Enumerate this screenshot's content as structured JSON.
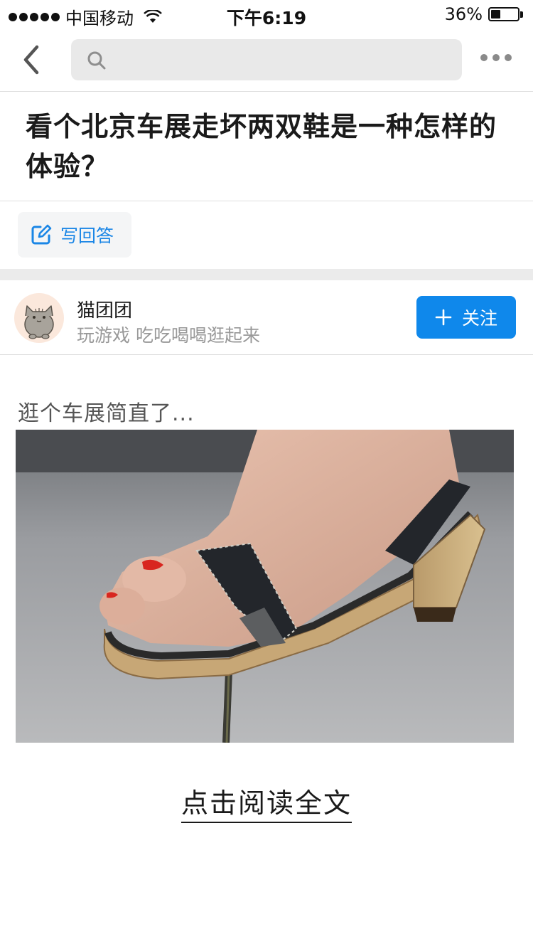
{
  "status_bar": {
    "carrier": "中国移动",
    "time": "下午6:19",
    "battery_percent": "36%",
    "battery_level": 0.36
  },
  "nav": {
    "search_placeholder": ""
  },
  "question": {
    "title": "看个北京车展走坏两双鞋是一种怎样的体验？"
  },
  "actions": {
    "write_answer_label": "写回答"
  },
  "author": {
    "name": "猫团团",
    "bio": "玩游戏 吃吃喝喝逛起来",
    "follow_label": "关注"
  },
  "answer": {
    "excerpt": "逛个车展简直了...",
    "read_more_label": "点击阅读全文"
  },
  "colors": {
    "accent": "#0f88eb",
    "link_blue": "#1a86e6",
    "muted_text": "#999999"
  }
}
